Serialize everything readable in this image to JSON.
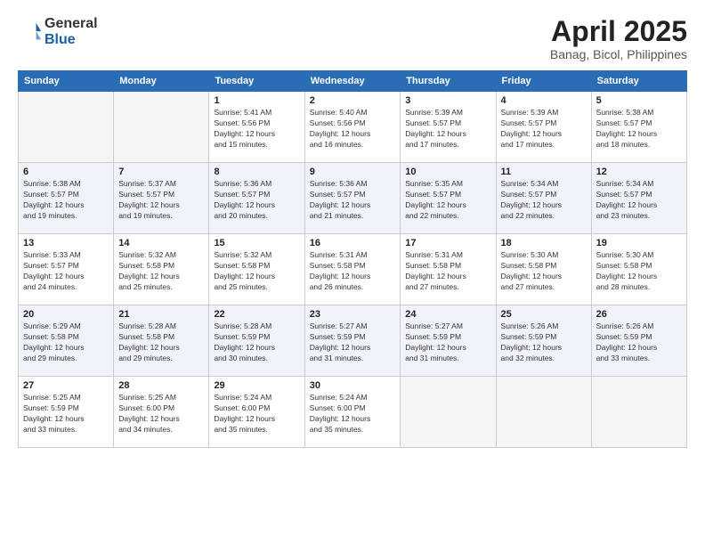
{
  "logo": {
    "general": "General",
    "blue": "Blue"
  },
  "title": "April 2025",
  "location": "Banag, Bicol, Philippines",
  "headers": [
    "Sunday",
    "Monday",
    "Tuesday",
    "Wednesday",
    "Thursday",
    "Friday",
    "Saturday"
  ],
  "weeks": [
    [
      {
        "day": "",
        "info": ""
      },
      {
        "day": "",
        "info": ""
      },
      {
        "day": "1",
        "info": "Sunrise: 5:41 AM\nSunset: 5:56 PM\nDaylight: 12 hours\nand 15 minutes."
      },
      {
        "day": "2",
        "info": "Sunrise: 5:40 AM\nSunset: 5:56 PM\nDaylight: 12 hours\nand 16 minutes."
      },
      {
        "day": "3",
        "info": "Sunrise: 5:39 AM\nSunset: 5:57 PM\nDaylight: 12 hours\nand 17 minutes."
      },
      {
        "day": "4",
        "info": "Sunrise: 5:39 AM\nSunset: 5:57 PM\nDaylight: 12 hours\nand 17 minutes."
      },
      {
        "day": "5",
        "info": "Sunrise: 5:38 AM\nSunset: 5:57 PM\nDaylight: 12 hours\nand 18 minutes."
      }
    ],
    [
      {
        "day": "6",
        "info": "Sunrise: 5:38 AM\nSunset: 5:57 PM\nDaylight: 12 hours\nand 19 minutes."
      },
      {
        "day": "7",
        "info": "Sunrise: 5:37 AM\nSunset: 5:57 PM\nDaylight: 12 hours\nand 19 minutes."
      },
      {
        "day": "8",
        "info": "Sunrise: 5:36 AM\nSunset: 5:57 PM\nDaylight: 12 hours\nand 20 minutes."
      },
      {
        "day": "9",
        "info": "Sunrise: 5:36 AM\nSunset: 5:57 PM\nDaylight: 12 hours\nand 21 minutes."
      },
      {
        "day": "10",
        "info": "Sunrise: 5:35 AM\nSunset: 5:57 PM\nDaylight: 12 hours\nand 22 minutes."
      },
      {
        "day": "11",
        "info": "Sunrise: 5:34 AM\nSunset: 5:57 PM\nDaylight: 12 hours\nand 22 minutes."
      },
      {
        "day": "12",
        "info": "Sunrise: 5:34 AM\nSunset: 5:57 PM\nDaylight: 12 hours\nand 23 minutes."
      }
    ],
    [
      {
        "day": "13",
        "info": "Sunrise: 5:33 AM\nSunset: 5:57 PM\nDaylight: 12 hours\nand 24 minutes."
      },
      {
        "day": "14",
        "info": "Sunrise: 5:32 AM\nSunset: 5:58 PM\nDaylight: 12 hours\nand 25 minutes."
      },
      {
        "day": "15",
        "info": "Sunrise: 5:32 AM\nSunset: 5:58 PM\nDaylight: 12 hours\nand 25 minutes."
      },
      {
        "day": "16",
        "info": "Sunrise: 5:31 AM\nSunset: 5:58 PM\nDaylight: 12 hours\nand 26 minutes."
      },
      {
        "day": "17",
        "info": "Sunrise: 5:31 AM\nSunset: 5:58 PM\nDaylight: 12 hours\nand 27 minutes."
      },
      {
        "day": "18",
        "info": "Sunrise: 5:30 AM\nSunset: 5:58 PM\nDaylight: 12 hours\nand 27 minutes."
      },
      {
        "day": "19",
        "info": "Sunrise: 5:30 AM\nSunset: 5:58 PM\nDaylight: 12 hours\nand 28 minutes."
      }
    ],
    [
      {
        "day": "20",
        "info": "Sunrise: 5:29 AM\nSunset: 5:58 PM\nDaylight: 12 hours\nand 29 minutes."
      },
      {
        "day": "21",
        "info": "Sunrise: 5:28 AM\nSunset: 5:58 PM\nDaylight: 12 hours\nand 29 minutes."
      },
      {
        "day": "22",
        "info": "Sunrise: 5:28 AM\nSunset: 5:59 PM\nDaylight: 12 hours\nand 30 minutes."
      },
      {
        "day": "23",
        "info": "Sunrise: 5:27 AM\nSunset: 5:59 PM\nDaylight: 12 hours\nand 31 minutes."
      },
      {
        "day": "24",
        "info": "Sunrise: 5:27 AM\nSunset: 5:59 PM\nDaylight: 12 hours\nand 31 minutes."
      },
      {
        "day": "25",
        "info": "Sunrise: 5:26 AM\nSunset: 5:59 PM\nDaylight: 12 hours\nand 32 minutes."
      },
      {
        "day": "26",
        "info": "Sunrise: 5:26 AM\nSunset: 5:59 PM\nDaylight: 12 hours\nand 33 minutes."
      }
    ],
    [
      {
        "day": "27",
        "info": "Sunrise: 5:25 AM\nSunset: 5:59 PM\nDaylight: 12 hours\nand 33 minutes."
      },
      {
        "day": "28",
        "info": "Sunrise: 5:25 AM\nSunset: 6:00 PM\nDaylight: 12 hours\nand 34 minutes."
      },
      {
        "day": "29",
        "info": "Sunrise: 5:24 AM\nSunset: 6:00 PM\nDaylight: 12 hours\nand 35 minutes."
      },
      {
        "day": "30",
        "info": "Sunrise: 5:24 AM\nSunset: 6:00 PM\nDaylight: 12 hours\nand 35 minutes."
      },
      {
        "day": "",
        "info": ""
      },
      {
        "day": "",
        "info": ""
      },
      {
        "day": "",
        "info": ""
      }
    ]
  ]
}
